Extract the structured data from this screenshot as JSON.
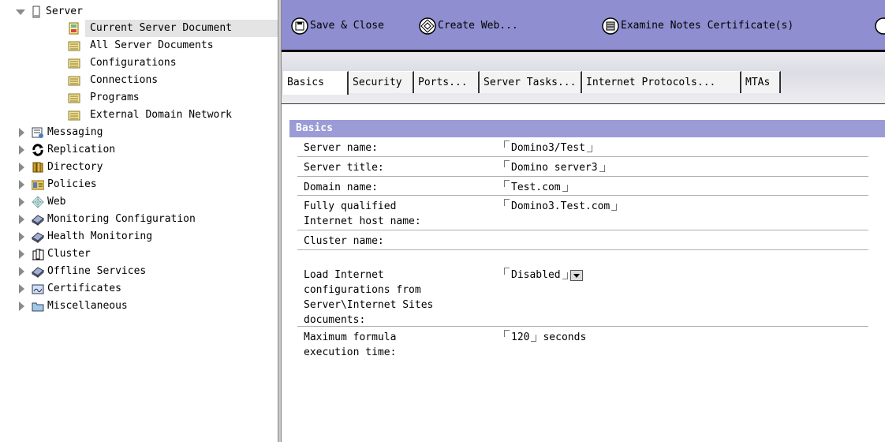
{
  "navigator": {
    "server": {
      "label": "Server",
      "expanded": true
    },
    "server_children": [
      {
        "label": "Current Server Document",
        "icon": "document-icon",
        "selected": true
      },
      {
        "label": "All Server Documents",
        "icon": "view-icon"
      },
      {
        "label": "Configurations",
        "icon": "view-icon"
      },
      {
        "label": "Connections",
        "icon": "view-icon"
      },
      {
        "label": "Programs",
        "icon": "view-icon"
      },
      {
        "label": "External Domain Network",
        "icon": "view-icon"
      }
    ],
    "categories": [
      {
        "label": "Messaging",
        "icon": "messaging-icon"
      },
      {
        "label": "Replication",
        "icon": "replication-icon"
      },
      {
        "label": "Directory",
        "icon": "directory-icon"
      },
      {
        "label": "Policies",
        "icon": "policies-icon"
      },
      {
        "label": "Web",
        "icon": "web-icon"
      },
      {
        "label": "Monitoring Configuration",
        "icon": "book-icon"
      },
      {
        "label": "Health Monitoring",
        "icon": "book-icon"
      },
      {
        "label": "Cluster",
        "icon": "cluster-icon"
      },
      {
        "label": "Offline Services",
        "icon": "book-icon"
      },
      {
        "label": "Certificates",
        "icon": "certificates-icon"
      },
      {
        "label": "Miscellaneous",
        "icon": "folder-icon"
      }
    ]
  },
  "toolbar": {
    "save_close": "Save & Close",
    "create_web": "Create Web...",
    "examine_cert": "Examine Notes Certificate(s)"
  },
  "tabs": [
    "Basics",
    "Security",
    "Ports...",
    "Server Tasks...",
    "Internet Protocols...",
    "MTAs"
  ],
  "active_tab": "Basics",
  "form": {
    "section_title": "Basics",
    "server_name_label": "Server name:",
    "server_name": "Domino3/Test",
    "server_title_label": "Server title:",
    "server_title": "Domino server3",
    "domain_name_label": "Domain name:",
    "domain_name": "Test.com",
    "fqdn_label": "Fully qualified\nInternet host name:",
    "fqdn": "Domino3.Test.com",
    "cluster_name_label": "Cluster name:",
    "cluster_name": "",
    "load_internet_label": "Load Internet\nconfigurations from\nServer\\Internet Sites\ndocuments:",
    "load_internet": "Disabled",
    "max_formula_label": "Maximum formula\nexecution time:",
    "max_formula": "120",
    "max_formula_unit": "seconds"
  },
  "colors": {
    "toolbar_bg": "#8e8ed0",
    "section_bg": "#9b9bd6"
  }
}
